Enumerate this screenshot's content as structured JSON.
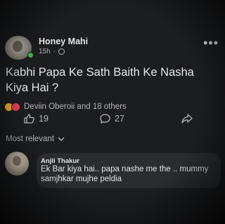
{
  "post": {
    "author": "Honey Mahi",
    "time": "15h",
    "menu_icon": "more-icon",
    "text": "Kabhi Papa Ke Sath Baith Ke Nasha Kiya Hai ?"
  },
  "reactions": {
    "types": [
      "haha",
      "love"
    ],
    "summary": "Deviin Oberoii and 18 others"
  },
  "actions": {
    "likes": "19",
    "comments": "27",
    "share_icon": "share-icon"
  },
  "comments_section": {
    "sort_label": "Most relevant",
    "comments": [
      {
        "author": "Anjli Thakur",
        "text": "Ek Bar kiya hai.. papa nashe me the .. mummy samjhkar mujhe peldia"
      }
    ]
  },
  "colors": {
    "background": "#1c1d1f",
    "text": "#e4e6eb",
    "secondary_text": "#b0b3b8",
    "bubble": "#2b2c2e",
    "online": "#3fbd4a",
    "haha": "#f7b125",
    "love": "#f33e58"
  }
}
